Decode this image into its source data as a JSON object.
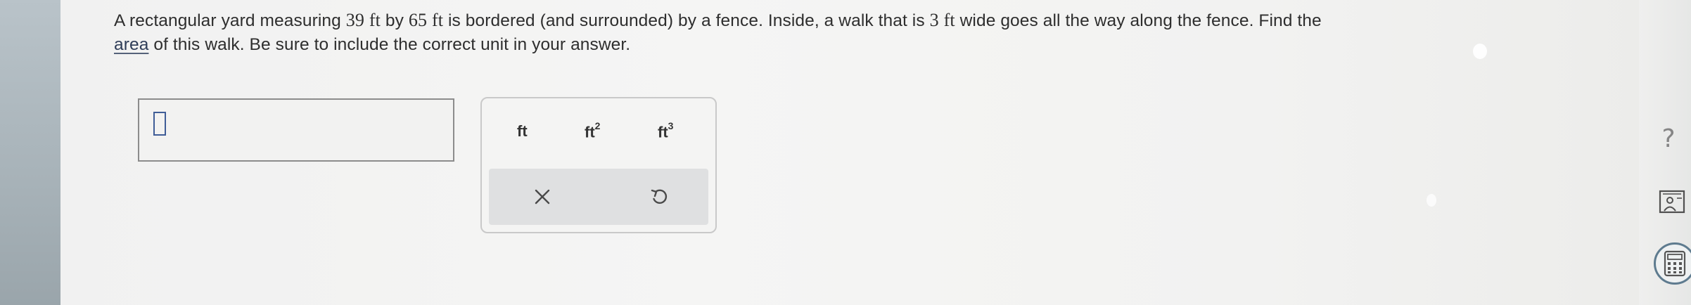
{
  "question": {
    "part1": "A rectangular yard measuring ",
    "num1": "39",
    "unit1": "ft",
    "part2": " by ",
    "num2": "65",
    "unit2": "ft",
    "part3": " is bordered (and surrounded) by a fence. Inside, a walk that is ",
    "num3": "3",
    "unit3": "ft",
    "part4": " wide goes all the way along the fence. Find the ",
    "link_text": "area",
    "part5": " of this walk. Be sure to include the correct unit in your answer."
  },
  "answer": {
    "value": ""
  },
  "keypad": {
    "units": [
      {
        "base": "ft",
        "exp": ""
      },
      {
        "base": "ft",
        "exp": "2"
      },
      {
        "base": "ft",
        "exp": "3"
      }
    ],
    "clear_icon": "x-icon",
    "undo_icon": "undo-icon"
  },
  "sidebar": {
    "help_label": "?",
    "icons": [
      "help-icon",
      "reader-icon",
      "calculator-icon"
    ]
  }
}
